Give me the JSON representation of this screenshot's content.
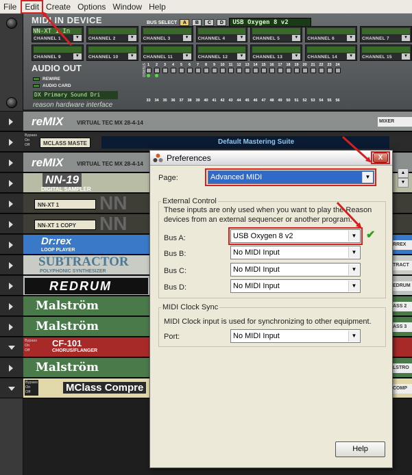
{
  "menubar": {
    "items": [
      "File",
      "Edit",
      "Create",
      "Options",
      "Window",
      "Help"
    ]
  },
  "hardware": {
    "title": "MIDI IN DEVICE",
    "nnxt_label": "NN-XT 1 In",
    "bus_select_label": "BUS SELECT",
    "bus_buttons": [
      "A",
      "B",
      "C",
      "D"
    ],
    "bus_display": "USB Oxygen 8 v2",
    "channels_row1": [
      "CHANNEL 1",
      "CHANNEL 2",
      "CHANNEL 3",
      "CHANNEL 4",
      "CHANNEL 5",
      "CHANNEL 6",
      "CHANNEL 7"
    ],
    "channels_row2": [
      "CHANNEL 9",
      "CHANNEL 10",
      "CHANNEL 11",
      "CHANNEL 12",
      "CHANNEL 13",
      "CHANNEL 14",
      "CHANNEL 15"
    ],
    "audio_out_title": "AUDIO OUT",
    "audio_opts": [
      "REWIRE",
      "AUDIO CARD"
    ],
    "driver": "DX Primary Sound Dri",
    "footer": "reason hardware interface",
    "stereo_label": "STEREO",
    "outs_top": [
      "1",
      "2",
      "3",
      "4",
      "5",
      "6",
      "7",
      "8",
      "9",
      "10",
      "11",
      "12",
      "13",
      "14",
      "15",
      "16",
      "17",
      "18",
      "19",
      "20",
      "21",
      "22",
      "23",
      "24"
    ],
    "outs_bottom": [
      "33",
      "34",
      "35",
      "36",
      "37",
      "38",
      "39",
      "40",
      "41",
      "42",
      "43",
      "44",
      "45",
      "46",
      "47",
      "48",
      "49",
      "50",
      "51",
      "52",
      "53",
      "54",
      "55",
      "56"
    ]
  },
  "rack": [
    {
      "name": "reMIX",
      "sub": "VIRTUAL TEC MX 28-4-14",
      "tag": "MIXER",
      "color": "#8a8e8c"
    },
    {
      "name": "MCLASS MASTE",
      "sub": "Default Mastering Suite",
      "tag": "",
      "color": "#2a2a2a"
    },
    {
      "name": "reMIX",
      "sub": "VIRTUAL TEC MX 28-4-14",
      "tag": "",
      "color": "#8a8e8c"
    },
    {
      "name": "NN-19",
      "sub": "DIGITAL SAMPLER",
      "tag": "",
      "color": "#b8bca4"
    },
    {
      "name": "NN-XT 1",
      "sub": "",
      "tag": "",
      "color": "#3e3e36"
    },
    {
      "name": "NN-XT 1 COPY",
      "sub": "",
      "tag": "",
      "color": "#3e3e36"
    },
    {
      "name": "Dr:rex",
      "sub": "LOOP PLAYER",
      "tag": "RREX",
      "color": "#3a78c8"
    },
    {
      "name": "SUBTRACTOR",
      "sub": "POLYPHONIC SYNTHESIZER",
      "tag": "TRACT",
      "color": "#c8ccc4"
    },
    {
      "name": "REDRUM",
      "sub": "",
      "tag": "EDRUM",
      "color": "#c0c4c0"
    },
    {
      "name": "Malström",
      "sub": "",
      "tag": "ASS 2",
      "color": "#4a7a4a"
    },
    {
      "name": "Malström",
      "sub": "",
      "tag": "ASS 3",
      "color": "#4a7a4a"
    },
    {
      "name": "CF-101",
      "sub": "CHORUS/FLANGER",
      "tag": "",
      "color": "#a82a28"
    },
    {
      "name": "Malström",
      "sub": "",
      "tag": "LSTRO",
      "color": "#4a7a4a"
    },
    {
      "name": "MClass Compre",
      "sub": "",
      "tag": "COMP",
      "color": "#e0d8a8"
    }
  ],
  "dialog": {
    "title": "Preferences",
    "page_label": "Page:",
    "page_value": "Advanced MIDI",
    "ext_group": "External Control",
    "ext_desc_line1": "These inputs are only used when you want to play the Reason",
    "ext_desc_line2": "devices from an external sequencer or another program.",
    "bus_labels": [
      "Bus A:",
      "Bus B:",
      "Bus C:",
      "Bus D:"
    ],
    "bus_values": [
      "USB Oxygen 8 v2",
      "No MIDI Input",
      "No MIDI Input",
      "No MIDI Input"
    ],
    "clock_group": "MIDI Clock Sync",
    "clock_desc": "MIDI Clock input is used for synchronizing to other equipment.",
    "port_label": "Port:",
    "port_value": "No MIDI Input",
    "help_label": "Help",
    "close_label": "X"
  },
  "colors": {
    "annotation": "#d42020",
    "check": "#2aa020",
    "selection": "#3169c6"
  }
}
